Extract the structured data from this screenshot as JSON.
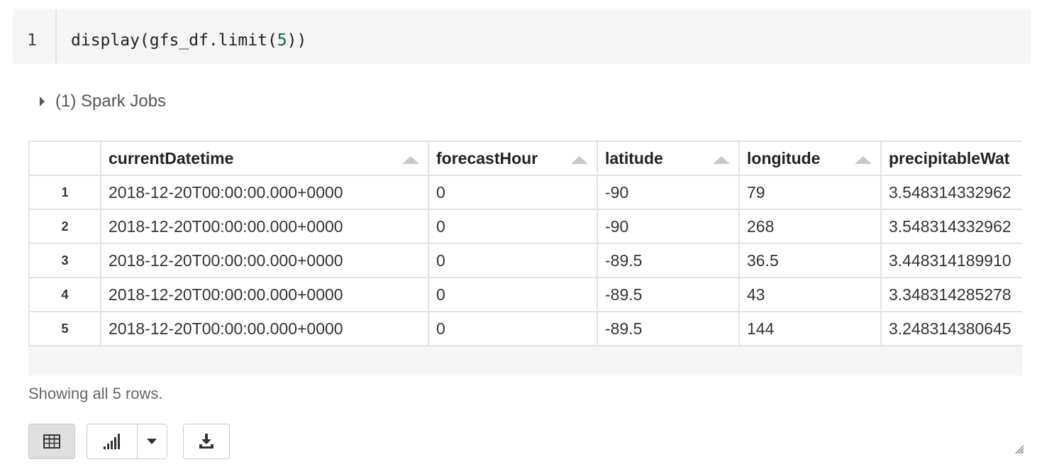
{
  "code": {
    "line_number": "1",
    "before": "display(gfs_df.limit(",
    "number": "5",
    "after": "))"
  },
  "spark_jobs_label": "(1) Spark Jobs",
  "table": {
    "columns": [
      "currentDatetime",
      "forecastHour",
      "latitude",
      "longitude",
      "precipitableWat"
    ],
    "rows": [
      {
        "index": "1",
        "cells": [
          "2018-12-20T00:00:00.000+0000",
          "0",
          "-90",
          "79",
          "3.548314332962"
        ]
      },
      {
        "index": "2",
        "cells": [
          "2018-12-20T00:00:00.000+0000",
          "0",
          "-90",
          "268",
          "3.548314332962"
        ]
      },
      {
        "index": "3",
        "cells": [
          "2018-12-20T00:00:00.000+0000",
          "0",
          "-89.5",
          "36.5",
          "3.448314189910"
        ]
      },
      {
        "index": "4",
        "cells": [
          "2018-12-20T00:00:00.000+0000",
          "0",
          "-89.5",
          "43",
          "3.348314285278"
        ]
      },
      {
        "index": "5",
        "cells": [
          "2018-12-20T00:00:00.000+0000",
          "0",
          "-89.5",
          "144",
          "3.248314380645"
        ]
      }
    ]
  },
  "footer_text": "Showing all 5 rows.",
  "toolbar": {
    "table_icon": "table-icon",
    "chart_icon": "bar-chart-icon",
    "dropdown_icon": "chevron-down-icon",
    "download_icon": "download-icon"
  },
  "colors": {
    "code_background": "#f5f5f5",
    "number_literal": "#116644",
    "grid_border": "#e2e2e2",
    "active_button": "#e0e0e0"
  }
}
